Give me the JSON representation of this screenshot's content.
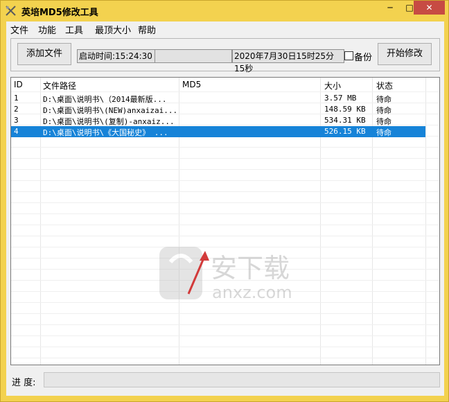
{
  "window": {
    "title": "英培MD5修改工具",
    "controls": {
      "minimize": "─",
      "maximize": "□",
      "close": "✕"
    }
  },
  "menubar": [
    "文件",
    "功能",
    "工具",
    "最顶大小",
    "帮助"
  ],
  "toolbar": {
    "add_file": "添加文件",
    "start_time": "启动时间:15:24:30",
    "blank": "",
    "datetime": "2020年7月30日15时25分15秒",
    "backup": "备份",
    "start": "开始修改"
  },
  "table": {
    "columns": [
      "ID",
      "文件路径",
      "MD5",
      "大小",
      "状态"
    ],
    "rows": [
      {
        "id": "1",
        "path": "D:\\桌面\\说明书\\（2014最新版...",
        "md5": "",
        "size": "3.57 MB",
        "status": "待命"
      },
      {
        "id": "2",
        "path": "D:\\桌面\\说明书\\(NEW)anxaizai...",
        "md5": "",
        "size": "148.59 KB",
        "status": "待命"
      },
      {
        "id": "3",
        "path": "D:\\桌面\\说明书\\(复制)-anxaiz...",
        "md5": "",
        "size": "534.31 KB",
        "status": "待命"
      },
      {
        "id": "4",
        "path": "D:\\桌面\\说明书\\《大国秘史》 ...",
        "md5": "",
        "size": "526.15 KB",
        "status": "待命"
      }
    ],
    "selected_row_index": 3
  },
  "progress": {
    "label": "进 度:",
    "value": 0
  },
  "watermark": {
    "cn": "安下载",
    "en": "anxz.com"
  },
  "colors": {
    "title_bg": "#f3d24f",
    "selection": "#1683d8",
    "close": "#c74b43"
  }
}
